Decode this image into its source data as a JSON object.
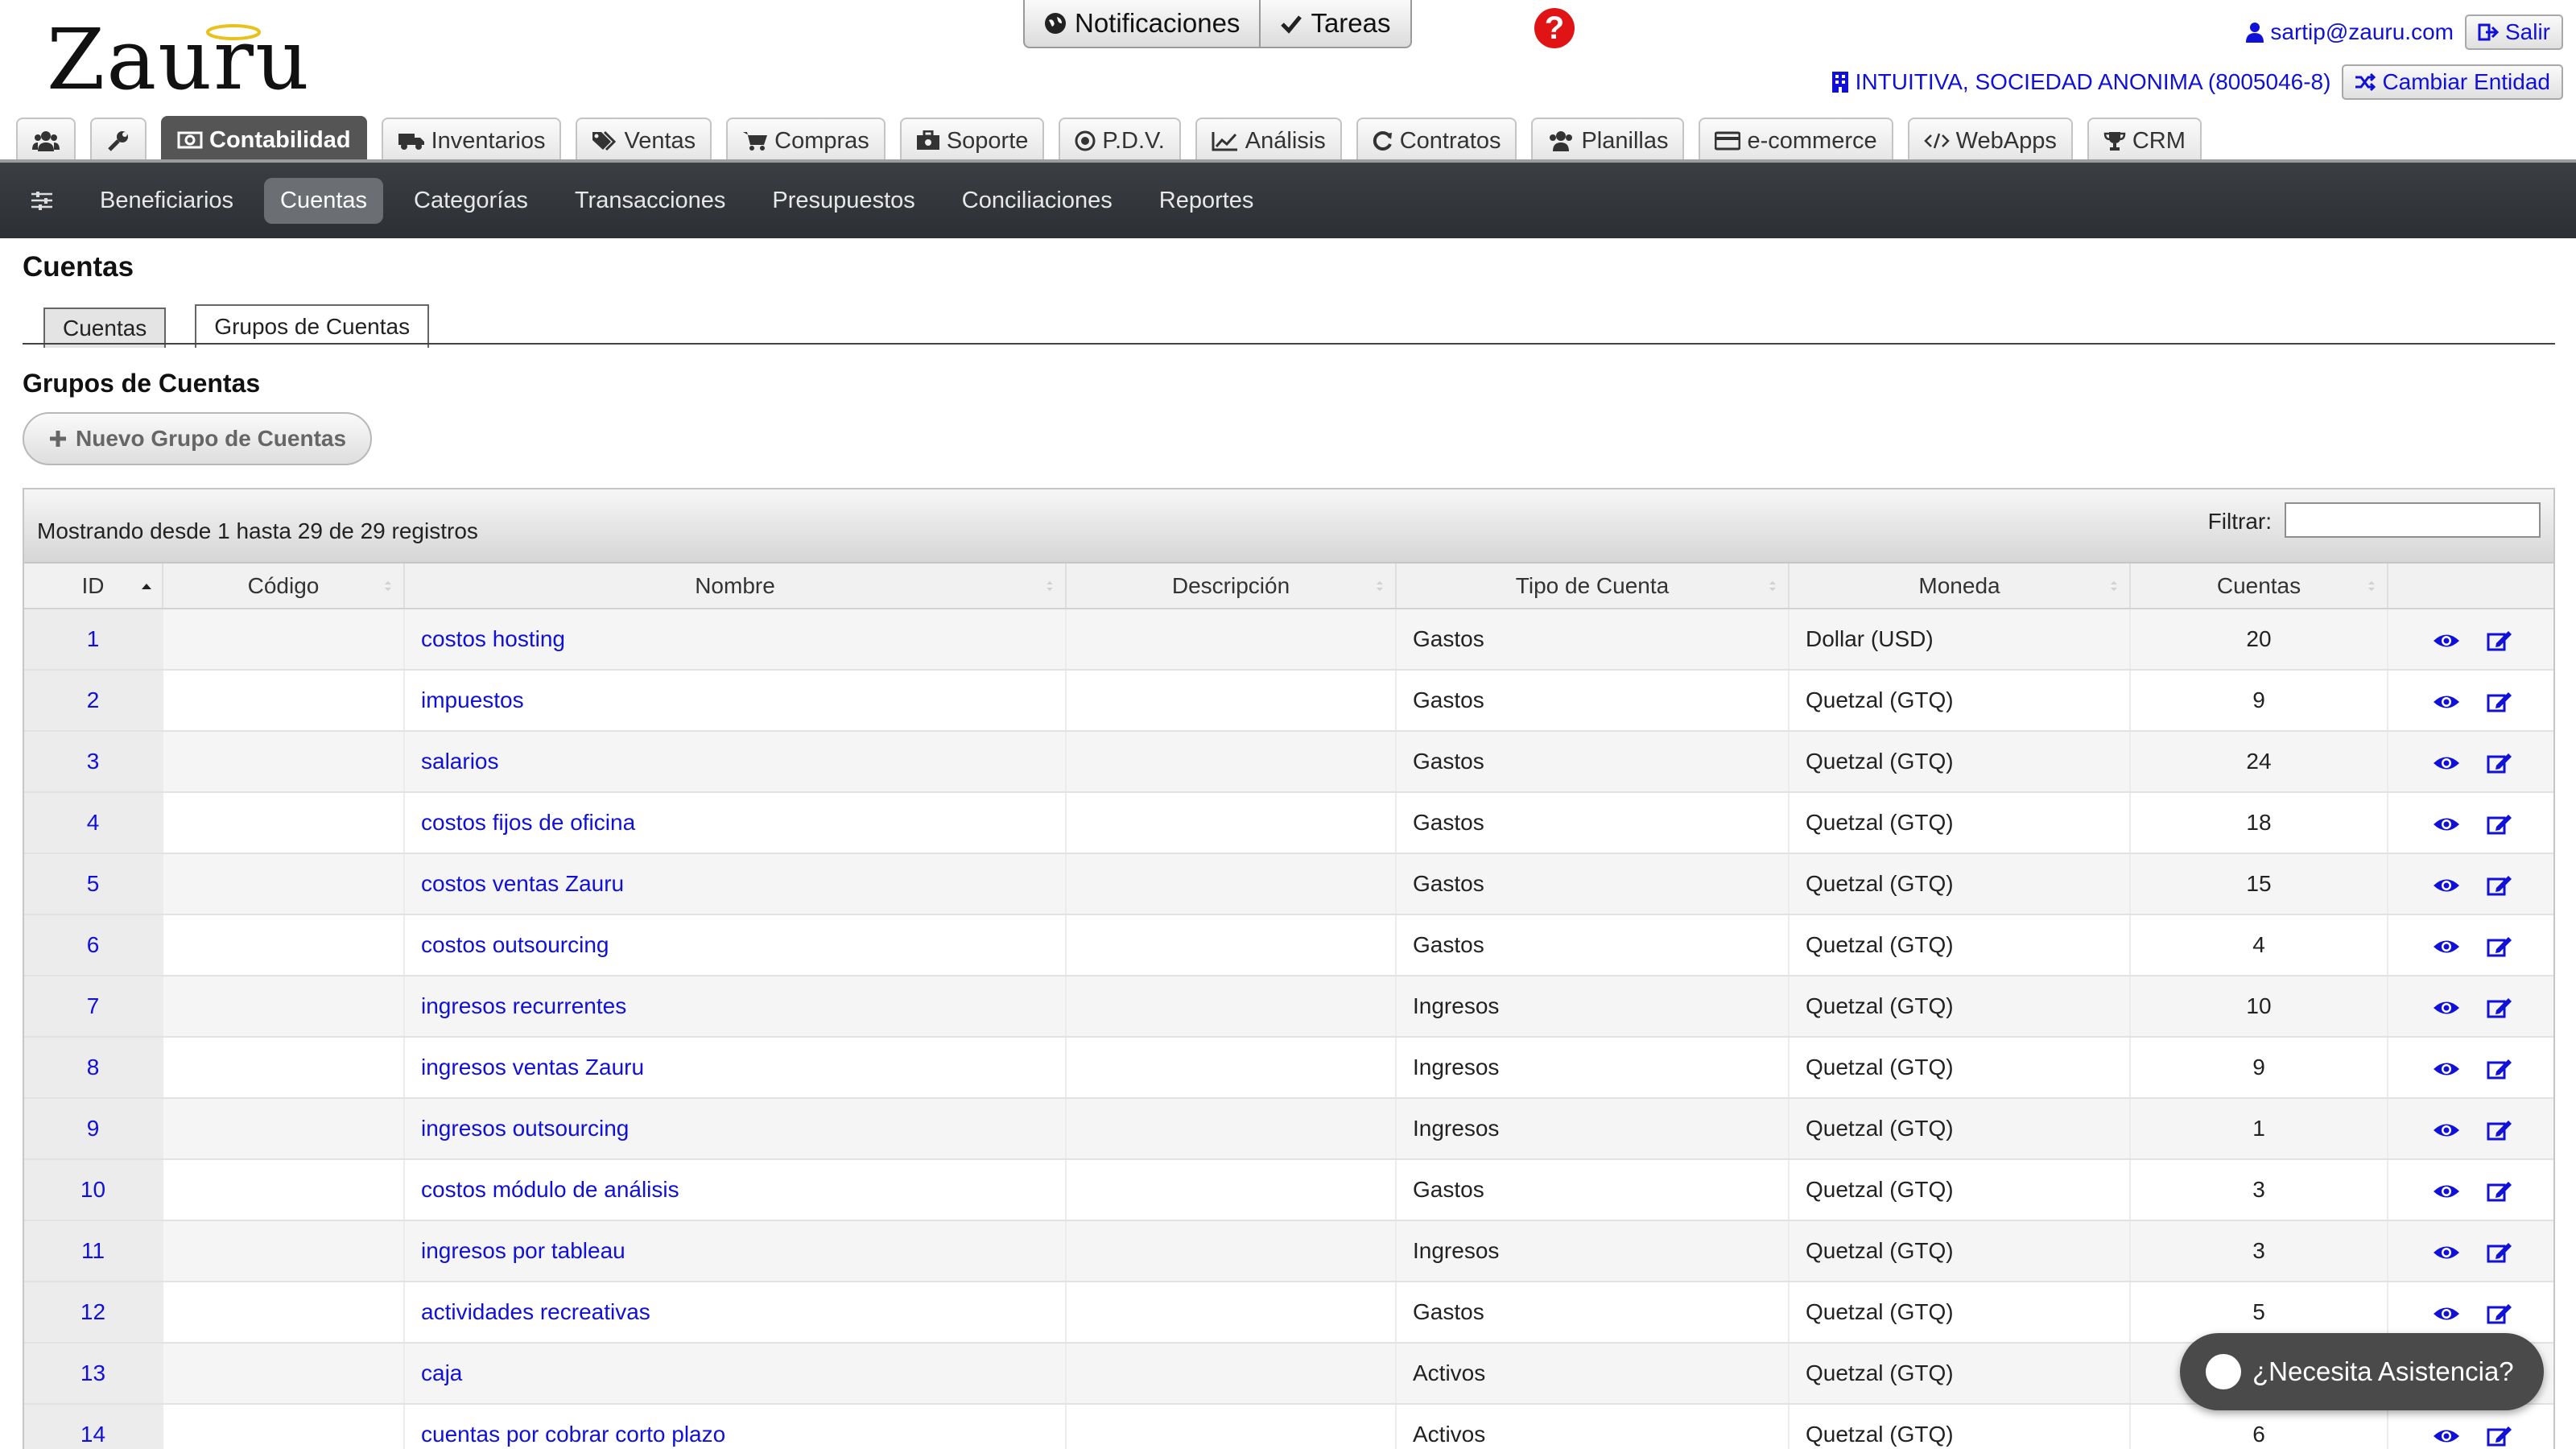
{
  "logo_text": "Zauru",
  "top_buttons": {
    "notifications": "Notificaciones",
    "tasks": "Tareas"
  },
  "user": {
    "email": "sartip@zauru.com",
    "logout": "Salir"
  },
  "entity": {
    "name": "INTUITIVA, SOCIEDAD ANONIMA (8005046-8)",
    "change": "Cambiar Entidad"
  },
  "module_tabs": [
    {
      "label": "",
      "icon": "users-icon"
    },
    {
      "label": "",
      "icon": "wrench-icon"
    },
    {
      "label": "Contabilidad",
      "icon": "money-icon",
      "active": true
    },
    {
      "label": "Inventarios",
      "icon": "truck-icon"
    },
    {
      "label": "Ventas",
      "icon": "tags-icon"
    },
    {
      "label": "Compras",
      "icon": "cart-icon"
    },
    {
      "label": "Soporte",
      "icon": "briefcase-icon"
    },
    {
      "label": "P.D.V.",
      "icon": "disc-icon"
    },
    {
      "label": "Análisis",
      "icon": "chart-icon"
    },
    {
      "label": "Contratos",
      "icon": "refresh-icon"
    },
    {
      "label": "Planillas",
      "icon": "group-icon"
    },
    {
      "label": "e-commerce",
      "icon": "credit-card-icon"
    },
    {
      "label": "WebApps",
      "icon": "code-icon"
    },
    {
      "label": "CRM",
      "icon": "trophy-icon"
    }
  ],
  "subnav": {
    "items": [
      "Beneficiarios",
      "Cuentas",
      "Categorías",
      "Transacciones",
      "Presupuestos",
      "Conciliaciones",
      "Reportes"
    ],
    "active": "Cuentas"
  },
  "page_title": "Cuentas",
  "inner_tabs": [
    "Cuentas",
    "Grupos de Cuentas"
  ],
  "section_title": "Grupos de Cuentas",
  "new_button": "Nuevo Grupo de Cuentas",
  "table": {
    "info": "Mostrando desde 1 hasta 29 de 29 registros",
    "filter_label": "Filtrar:",
    "filter_value": "",
    "headers": [
      "ID",
      "Código",
      "Nombre",
      "Descripción",
      "Tipo de Cuenta",
      "Moneda",
      "Cuentas",
      ""
    ],
    "rows": [
      [
        "1",
        "",
        "costos hosting",
        "",
        "Gastos",
        "Dollar (USD)",
        "20"
      ],
      [
        "2",
        "",
        "impuestos",
        "",
        "Gastos",
        "Quetzal (GTQ)",
        "9"
      ],
      [
        "3",
        "",
        "salarios",
        "",
        "Gastos",
        "Quetzal (GTQ)",
        "24"
      ],
      [
        "4",
        "",
        "costos fijos de oficina",
        "",
        "Gastos",
        "Quetzal (GTQ)",
        "18"
      ],
      [
        "5",
        "",
        "costos ventas Zauru",
        "",
        "Gastos",
        "Quetzal (GTQ)",
        "15"
      ],
      [
        "6",
        "",
        "costos outsourcing",
        "",
        "Gastos",
        "Quetzal (GTQ)",
        "4"
      ],
      [
        "7",
        "",
        "ingresos recurrentes",
        "",
        "Ingresos",
        "Quetzal (GTQ)",
        "10"
      ],
      [
        "8",
        "",
        "ingresos ventas Zauru",
        "",
        "Ingresos",
        "Quetzal (GTQ)",
        "9"
      ],
      [
        "9",
        "",
        "ingresos outsourcing",
        "",
        "Ingresos",
        "Quetzal (GTQ)",
        "1"
      ],
      [
        "10",
        "",
        "costos módulo de análisis",
        "",
        "Gastos",
        "Quetzal (GTQ)",
        "3"
      ],
      [
        "11",
        "",
        "ingresos por tableau",
        "",
        "Ingresos",
        "Quetzal (GTQ)",
        "3"
      ],
      [
        "12",
        "",
        "actividades recreativas",
        "",
        "Gastos",
        "Quetzal (GTQ)",
        "5"
      ],
      [
        "13",
        "",
        "caja",
        "",
        "Activos",
        "Quetzal (GTQ)",
        ""
      ],
      [
        "14",
        "",
        "cuentas por cobrar corto plazo",
        "",
        "Activos",
        "Quetzal (GTQ)",
        "6"
      ]
    ]
  },
  "chat": {
    "label": "¿Necesita Asistencia?"
  },
  "colors": {
    "link": "#1010d8",
    "subnav_bg": "#2f3236",
    "active_tab": "#555555",
    "help": "#e01414"
  }
}
